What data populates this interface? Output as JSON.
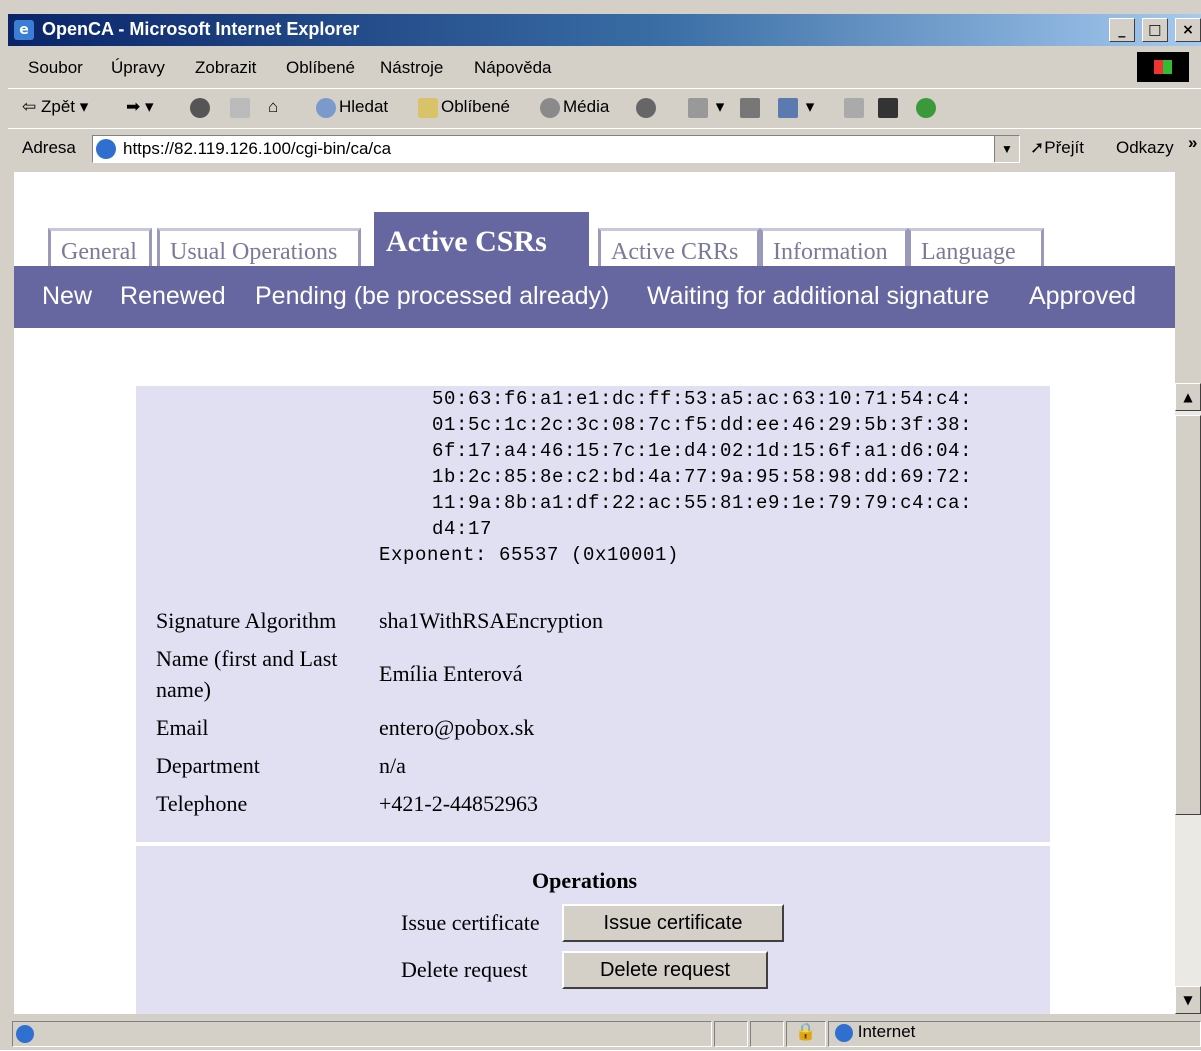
{
  "window": {
    "title": "OpenCA - Microsoft Internet Explorer",
    "controls": [
      "_",
      "□",
      "×"
    ]
  },
  "menu": [
    "Soubor",
    "Úpravy",
    "Zobrazit",
    "Oblíbené",
    "Nástroje",
    "Nápověda"
  ],
  "toolbar": {
    "back": "Zpět",
    "search": "Hledat",
    "favorites": "Oblíbené",
    "media": "Média"
  },
  "address": {
    "label": "Adresa",
    "url": "https://82.119.126.100/cgi-bin/ca/ca",
    "go": "Přejít",
    "links": "Odkazy"
  },
  "tabs": [
    "General",
    "Usual Operations",
    "Active CSRs",
    "Active CRRs",
    "Information",
    "Language"
  ],
  "subnav": [
    "New",
    "Renewed",
    "Pending (be processed already)",
    "Waiting for additional signature",
    "Approved"
  ],
  "modulus_lines": [
    "50:63:f6:a1:e1:dc:ff:53:a5:ac:63:10:71:54:c4:",
    "01:5c:1c:2c:3c:08:7c:f5:dd:ee:46:29:5b:3f:38:",
    "6f:17:a4:46:15:7c:1e:d4:02:1d:15:6f:a1:d6:04:",
    "1b:2c:85:8e:c2:bd:4a:77:9a:95:58:98:dd:69:72:",
    "11:9a:8b:a1:df:22:ac:55:81:e9:1e:79:79:c4:ca:",
    "d4:17"
  ],
  "exponent": "Exponent: 65537 (0x10001)",
  "fields": [
    {
      "label": "Signature Algorithm",
      "value": "sha1WithRSAEncryption"
    },
    {
      "label_line1": "Name (first and Last",
      "label_line2": "name)",
      "value": "Emília Enterová"
    },
    {
      "label": "Email",
      "value": "entero@pobox.sk"
    },
    {
      "label": "Department",
      "value": "n/a"
    },
    {
      "label": "Telephone",
      "value": "+421-2-44852963"
    }
  ],
  "operations": {
    "title": "Operations",
    "issue_label": "Issue certificate",
    "issue_button": "Issue certificate",
    "delete_label": "Delete request",
    "delete_button": "Delete request"
  },
  "status": {
    "zone": "Internet"
  }
}
